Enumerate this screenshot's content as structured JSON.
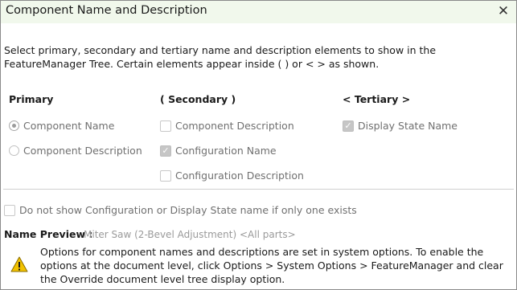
{
  "window": {
    "title": "Component Name and Description"
  },
  "description": "Select primary, secondary and tertiary name and description elements to show in the FeatureManager Tree. Certain elements appear inside ( ) or < > as shown.",
  "columns": {
    "primary": {
      "heading": "Primary",
      "options": [
        {
          "label": "Component Name",
          "checked": true
        },
        {
          "label": "Component Description",
          "checked": false
        }
      ]
    },
    "secondary": {
      "heading": "( Secondary )",
      "options": [
        {
          "label": "Component Description",
          "checked": false
        },
        {
          "label": "Configuration Name",
          "checked": true
        },
        {
          "label": "Configuration Description",
          "checked": false
        }
      ]
    },
    "tertiary": {
      "heading": "< Tertiary >",
      "options": [
        {
          "label": "Display State Name",
          "checked": true
        }
      ]
    }
  },
  "hide_option": {
    "label": "Do not show Configuration or Display State name if only one exists",
    "checked": false
  },
  "preview": {
    "label": "Name Preview :",
    "value": "Miter Saw (2-Bevel Adjustment) <All parts>"
  },
  "warning": {
    "text": "Options for component names and descriptions are set in system options. To enable the options at the document level, click Options > System Options > FeatureManager and clear the Override document level tree display option."
  },
  "icons": {
    "close": "close-icon",
    "warning": "warning-icon"
  },
  "colors": {
    "titlebar": "#f1f8ec",
    "warning_fill": "#f2c200",
    "disabled_text": "#707070"
  }
}
